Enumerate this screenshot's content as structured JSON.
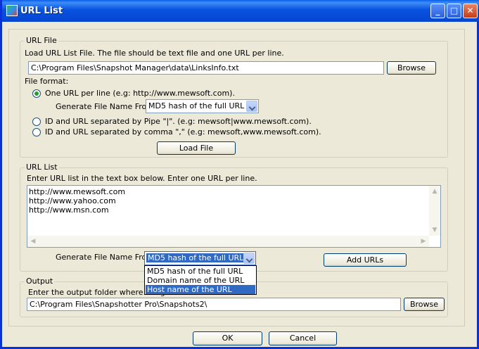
{
  "window": {
    "title": "URL List"
  },
  "titlebar_buttons": {
    "minimize": "_",
    "maximize": "□",
    "close": "✕"
  },
  "url_file": {
    "legend": "URL File",
    "description": "Load URL List File. The file should be text file and one URL per line.",
    "path_value": "C:\\Program Files\\Snapshot Manager\\data\\LinksInfo.txt",
    "browse_label": "Browse",
    "format_label": "File format:",
    "option_one_per_line": "One URL per line (e.g: http://www.mewsoft.com).",
    "generate_label": "Generate File Name From:",
    "generate_value": "MD5 hash of the full URL",
    "option_pipe": "ID and URL separated by Pipe \"|\". (e.g: mewsoft|www.mewsoft.com).",
    "option_comma": "ID and URL separated by comma \",\" (e.g: mewsoft,www.mewsoft.com).",
    "load_label": "Load File"
  },
  "url_list": {
    "legend": "URL List",
    "description": "Enter URL list in the text box below. Enter one URL per line.",
    "lines": [
      "http://www.mewsoft.com",
      "http://www.yahoo.com",
      "http://www.msn.com"
    ],
    "generate_label": "Generate File Name From:",
    "generate_value": "MD5 hash of the full URL",
    "add_label": "Add URLs",
    "dropdown_options": [
      "MD5 hash of the full URL",
      "Domain name of the URL",
      "Host name of the URL"
    ]
  },
  "output": {
    "legend": "Output",
    "description": "Enter the output folder where image",
    "path_value": "C:\\Program Files\\Snapshotter Pro\\Snapshots2\\",
    "browse_label": "Browse"
  },
  "footer": {
    "ok_label": "OK",
    "cancel_label": "Cancel"
  }
}
